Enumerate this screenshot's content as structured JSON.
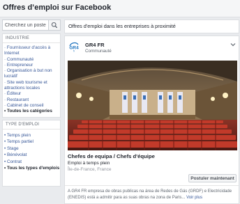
{
  "header": {
    "title": "Offres d’emploi sur Facebook"
  },
  "search": {
    "placeholder": "Cherchez un poste"
  },
  "industry": {
    "heading": "INDUSTRIE",
    "items": [
      {
        "label": "· Fournisseur d'accès à Internet"
      },
      {
        "label": "· Communauté"
      },
      {
        "label": "· Entrepreneur"
      },
      {
        "label": "· Organisation à but non lucratif"
      },
      {
        "label": "· Site web tourisme et attractions locales"
      },
      {
        "label": "· Éditeur"
      },
      {
        "label": "· Restaurant"
      },
      {
        "label": "· Cabinet de conseil"
      },
      {
        "label": "• Toutes les catégories"
      }
    ]
  },
  "job_type": {
    "heading": "TYPE D'EMPLOI",
    "items": [
      {
        "label": "• Temps plein"
      },
      {
        "label": "• Temps partiel"
      },
      {
        "label": "• Stage"
      },
      {
        "label": "• Bénévolat"
      },
      {
        "label": "• Contrat"
      },
      {
        "label": "• Tous les types d'emplois"
      }
    ]
  },
  "main": {
    "heading": "Offres d'emploi dans les entreprises à proximité"
  },
  "post": {
    "logo_text": "GR4fr",
    "page_name": "GR4 FR",
    "page_type": "Communauté",
    "job_title": "Chefes de equipa / Chefs d'équipe",
    "job_type": "Emploi à temps plein",
    "location": "Île-de-France, France",
    "apply_label": "Postuler maintenant",
    "description": "A GR4 FR empresa de obras publicas na área de Redes de Gás (GRDF) e Electricidade (ENEDIS) está a admitir para as suas obras na zona de Paris... ",
    "see_more": "Voir plus"
  },
  "colors": {
    "link": "#385898",
    "logo_blue": "#1e73be",
    "background": "#e9ebee"
  }
}
